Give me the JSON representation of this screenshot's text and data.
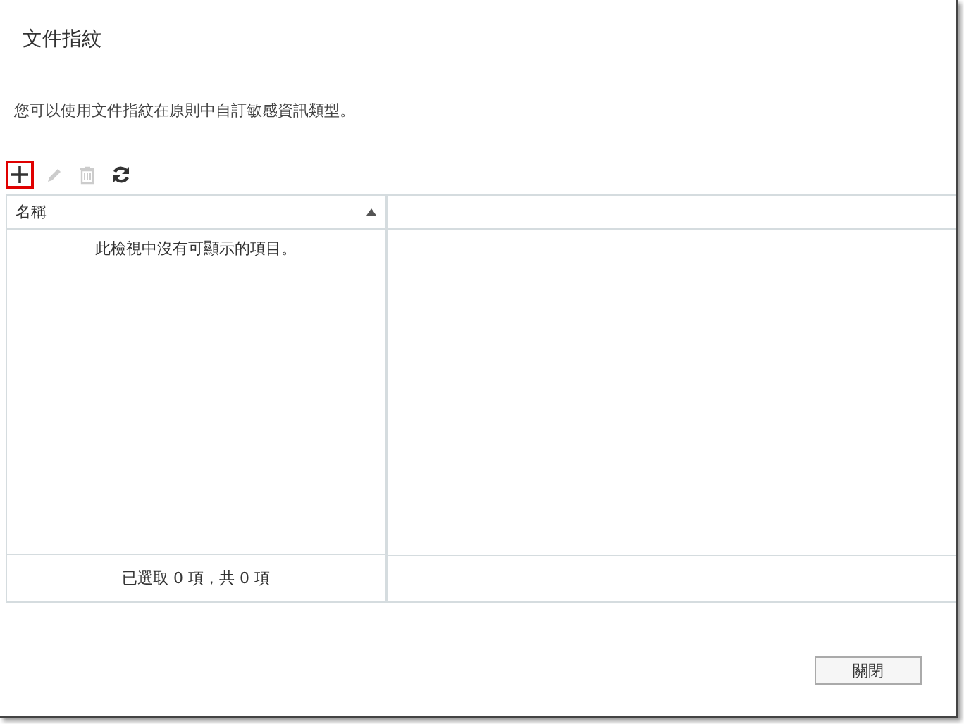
{
  "title": "文件指紋",
  "description": "您可以使用文件指紋在原則中自訂敏感資訊類型。",
  "toolbar": [
    {
      "kind": "add",
      "disabled": false,
      "highlighted": true
    },
    {
      "kind": "edit",
      "disabled": true,
      "highlighted": false
    },
    {
      "kind": "delete",
      "disabled": true,
      "highlighted": false
    },
    {
      "kind": "refresh",
      "disabled": false,
      "highlighted": false
    }
  ],
  "table": {
    "columns": [
      {
        "label": "名稱",
        "sort_ascending": true
      }
    ],
    "empty_message": "此檢視中沒有可顯示的項目。",
    "footer": "已選取 0 項，共 0 項"
  },
  "buttons": [
    {
      "label": "關閉"
    }
  ]
}
